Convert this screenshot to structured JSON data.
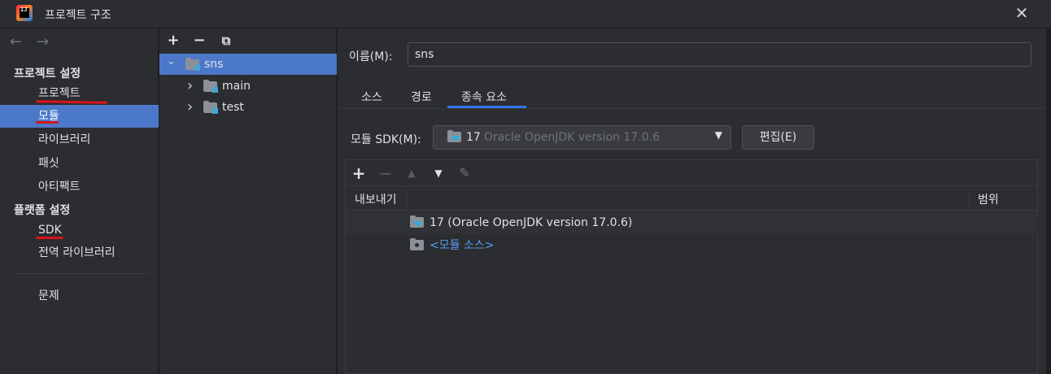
{
  "window": {
    "title": "프로젝트 구조",
    "app_icon_text": "IJ",
    "close_glyph": "✕"
  },
  "nav": {
    "back": "←",
    "forward": "→",
    "project_settings_header": "프로젝트 설정",
    "project_items": [
      "프로젝트",
      "모듈",
      "라이브러리",
      "패싯",
      "아티팩트"
    ],
    "platform_settings_header": "플랫폼 설정",
    "platform_items": [
      "SDK",
      "전역 라이브러리"
    ],
    "problems": "문제",
    "selected": "모듈"
  },
  "module_tree": {
    "toolbar": {
      "add": "+",
      "remove": "−",
      "copy": "⧉"
    },
    "root": {
      "label": "sns",
      "expanded": true
    },
    "children": [
      {
        "label": "main",
        "expanded": false
      },
      {
        "label": "test",
        "expanded": false
      }
    ],
    "chevron_down": "⌄",
    "chevron_right": "›"
  },
  "module_panel": {
    "name_label": "이름(M):",
    "name_value": "sns",
    "tabs": [
      "소스",
      "경로",
      "종속 요소"
    ],
    "active_tab": "종속 요소",
    "sdk_label": "모듈 SDK(M):",
    "sdk_version": "17",
    "sdk_description": "Oracle OpenJDK version 17.0.6",
    "sdk_caret": "▼",
    "edit_button": "편집(E)",
    "dependencies_toolbar": {
      "add": "+",
      "remove": "−",
      "up": "▲",
      "down": "▼",
      "edit": "✎"
    },
    "columns": {
      "export": "내보내기",
      "scope": "범위"
    },
    "rows": [
      {
        "label": "17 (Oracle OpenJDK version 17.0.6)",
        "type": "sdk"
      },
      {
        "label": "<모듈 소스>",
        "type": "source"
      }
    ]
  },
  "colors": {
    "selection": "#4c78c9",
    "accent_tab": "#3574f0",
    "link": "#589df6",
    "annotation_red": "#d8141a"
  }
}
